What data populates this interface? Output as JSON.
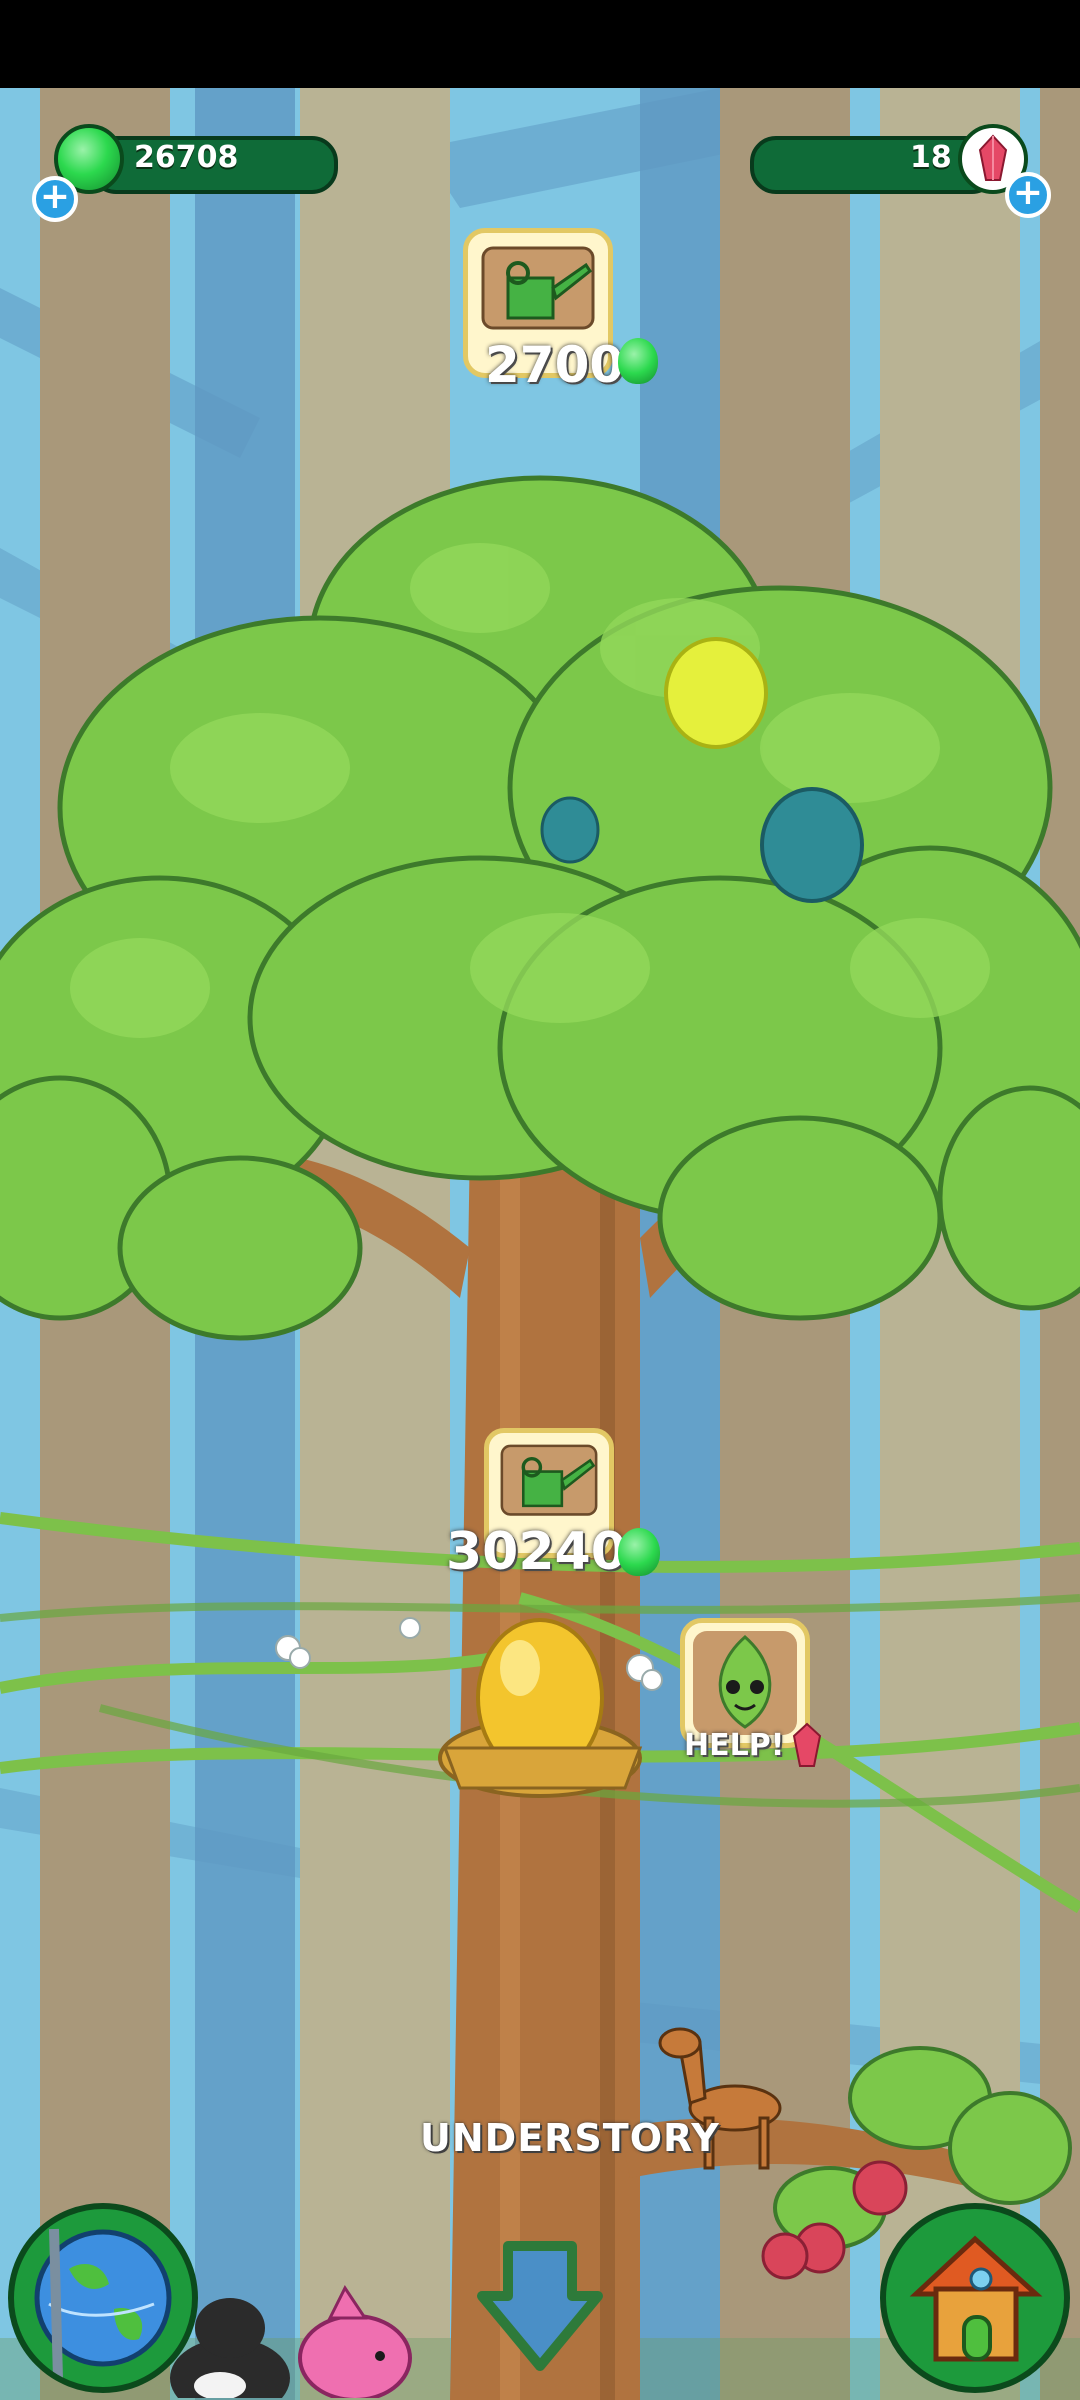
{
  "hud": {
    "gems_count": "26708",
    "crystals_count": "18",
    "gem_plus_icon": "plus-icon",
    "crystal_plus_icon": "plus-icon"
  },
  "upgrades": {
    "top_cost": "2700",
    "middle_cost": "30240",
    "icon": "watering-can-icon",
    "currency_icon": "green-gem-icon"
  },
  "help_bubble": {
    "label": "HELP!",
    "icon": "leaf-creature-icon",
    "reward_icon": "red-crystal-icon"
  },
  "area": {
    "label": "UNDERSTORY"
  },
  "nav": {
    "world_icon": "globe-icon",
    "down_icon": "down-arrow-icon",
    "home_icon": "house-icon"
  },
  "colors": {
    "sky": "#7fc6e3",
    "leaf": "#7cc84a",
    "trunk": "#b0733f",
    "hud_bar": "#0f6b38",
    "gem": "#2cd94e"
  }
}
